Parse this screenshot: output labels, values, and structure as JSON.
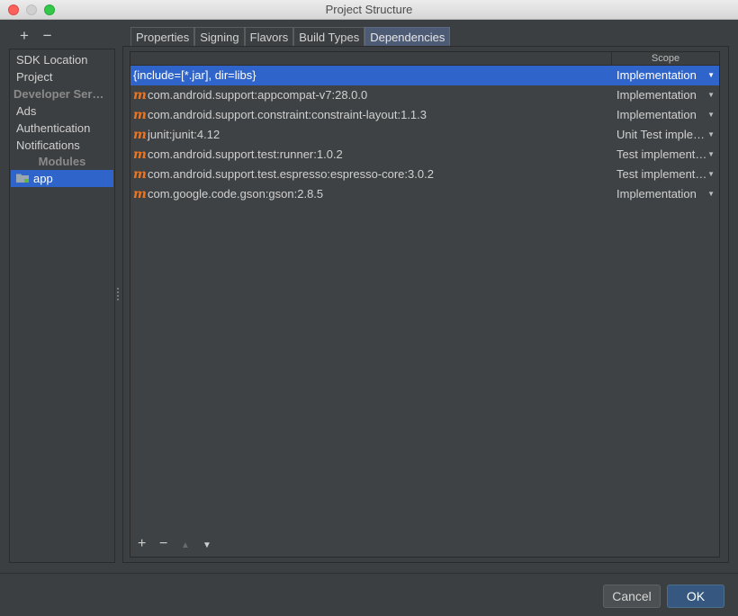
{
  "window": {
    "title": "Project Structure"
  },
  "sidebar_tools": {
    "add": "+",
    "remove": "−"
  },
  "sidebar": {
    "items": [
      {
        "label": "SDK Location"
      },
      {
        "label": "Project"
      }
    ],
    "section_developer": "Developer Ser…",
    "dev_items": [
      {
        "label": "Ads"
      },
      {
        "label": "Authentication"
      },
      {
        "label": "Notifications"
      }
    ],
    "section_modules": "Modules",
    "modules": [
      {
        "label": "app",
        "selected": true,
        "icon": "module-folder-icon"
      }
    ]
  },
  "tabs": [
    {
      "label": "Properties"
    },
    {
      "label": "Signing"
    },
    {
      "label": "Flavors"
    },
    {
      "label": "Build Types"
    },
    {
      "label": "Dependencies",
      "active": true
    }
  ],
  "table": {
    "columns": {
      "dependency": "",
      "scope": "Scope"
    },
    "rows": [
      {
        "dependency": "{include=[*.jar], dir=libs}",
        "icon": "",
        "scope": "Implementation",
        "selected": true
      },
      {
        "dependency": "com.android.support:appcompat-v7:28.0.0",
        "icon": "m",
        "scope": "Implementation"
      },
      {
        "dependency": "com.android.support.constraint:constraint-layout:1.1.3",
        "icon": "m",
        "scope": "Implementation"
      },
      {
        "dependency": "junit:junit:4.12",
        "icon": "m",
        "scope": "Unit Test imple…"
      },
      {
        "dependency": "com.android.support.test:runner:1.0.2",
        "icon": "m",
        "scope": "Test implement…"
      },
      {
        "dependency": "com.android.support.test.espresso:espresso-core:3.0.2",
        "icon": "m",
        "scope": "Test implement…"
      },
      {
        "dependency": "com.google.code.gson:gson:2.8.5",
        "icon": "m",
        "scope": "Implementation"
      }
    ],
    "tools": {
      "add": "+",
      "remove": "−",
      "up": "▲",
      "down": "▼"
    }
  },
  "buttons": {
    "cancel": "Cancel",
    "ok": "OK"
  },
  "colors": {
    "selection": "#2f65ca",
    "maven_icon": "#ee7520",
    "ok_button": "#365880"
  }
}
